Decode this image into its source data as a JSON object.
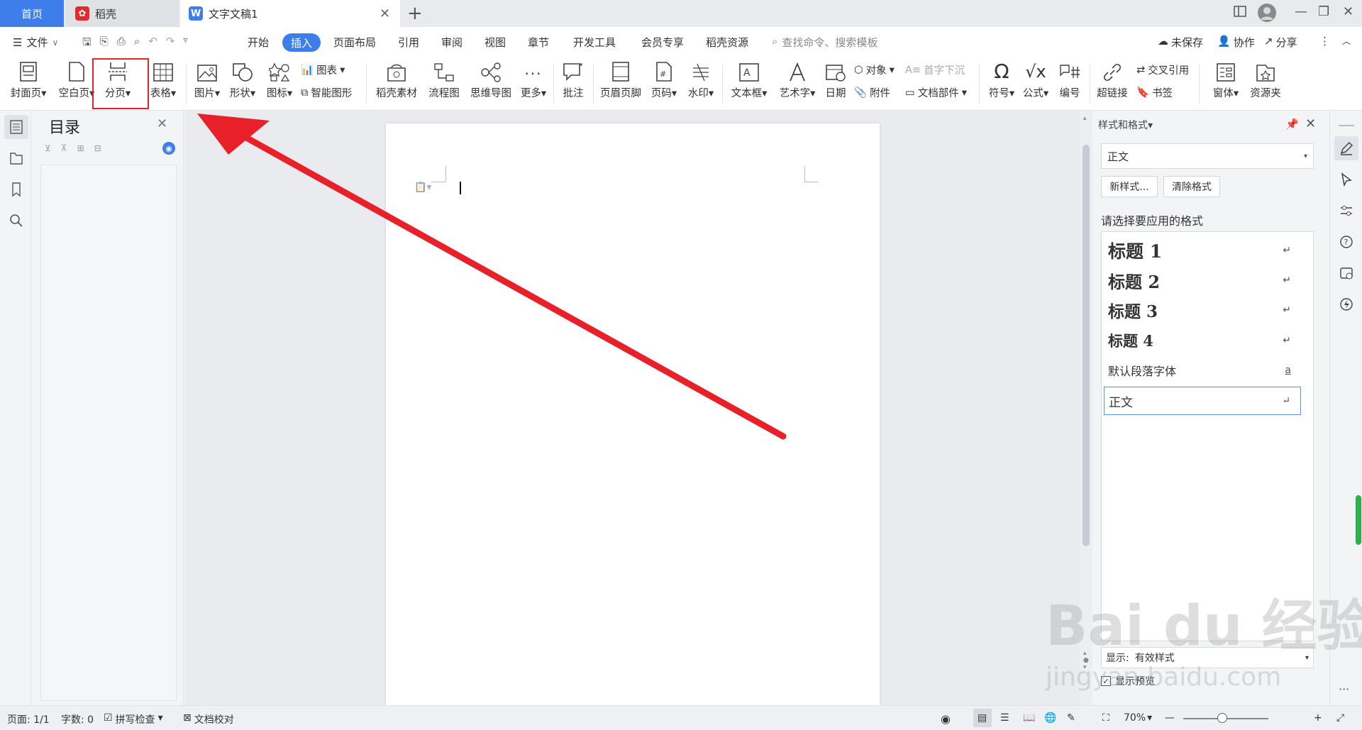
{
  "tabs": {
    "home": "首页",
    "daoke": "稻壳",
    "doc": "文字文稿1"
  },
  "menu": {
    "file": "文件",
    "items": [
      "开始",
      "插入",
      "页面布局",
      "引用",
      "审阅",
      "视图",
      "章节",
      "开发工具",
      "会员专享",
      "稻壳资源"
    ],
    "search_placeholder": "查找命令、搜索模板",
    "unsaved": "未保存",
    "collab": "协作",
    "share": "分享"
  },
  "ribbon": {
    "cover": "封面页",
    "blank": "空白页",
    "pagebreak": "分页",
    "table": "表格",
    "picture": "图片",
    "shape": "形状",
    "icon": "图标",
    "chart": "图表",
    "smartart": "智能图形",
    "daoke_material": "稻壳素材",
    "flowchart": "流程图",
    "mindmap": "思维导图",
    "more": "更多",
    "comment": "批注",
    "header_footer": "页眉页脚",
    "page_num": "页码",
    "watermark": "水印",
    "textbox": "文本框",
    "wordart": "艺术字",
    "date": "日期",
    "object": "对象",
    "attachment": "附件",
    "dropcap": "首字下沉",
    "doc_parts": "文档部件",
    "symbol": "符号",
    "formula": "公式",
    "numbering": "编号",
    "crossref": "交叉引用",
    "hyperlink": "超链接",
    "bookmark": "书签",
    "window": "窗体",
    "resource": "资源夹"
  },
  "toc": {
    "title": "目录"
  },
  "stylepane": {
    "title": "样式和格式",
    "current": "正文",
    "new_style": "新样式...",
    "clear_format": "清除格式",
    "prompt": "请选择要应用的格式",
    "styles": [
      {
        "name": "标题 1",
        "mark": "↵"
      },
      {
        "name": "标题 2",
        "mark": "↵"
      },
      {
        "name": "标题 3",
        "mark": "↵"
      },
      {
        "name": "标题 4",
        "mark": "↵"
      },
      {
        "name": "默认段落字体",
        "mark": "a"
      },
      {
        "name": "正文",
        "mark": "↵"
      }
    ],
    "show_label": "显示:",
    "show_value": "有效样式",
    "preview": "显示预览"
  },
  "status": {
    "page": "页面: 1/1",
    "words": "字数: 0",
    "spell": "拼写检查",
    "proof": "文档校对",
    "zoom": "70%"
  },
  "watermark": {
    "text": "Bai du 经验",
    "url": "jingyan.baidu.com"
  },
  "colors": {
    "accent": "#3d7eea",
    "arrow": "#e8202a",
    "highlight": "#e8202a"
  }
}
